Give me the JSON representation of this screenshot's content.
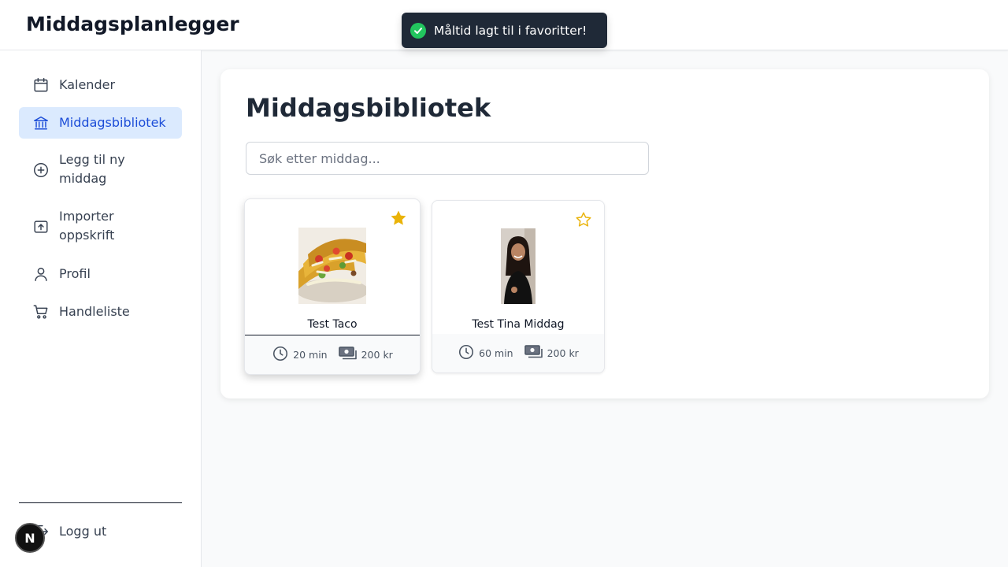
{
  "app": {
    "title": "Middagsplanlegger"
  },
  "toast": {
    "message": "Måltid lagt til i favoritter!",
    "color": "#1f2937",
    "icon": "check-circle-icon"
  },
  "sidebar": {
    "items": [
      {
        "label": "Kalender",
        "icon": "calendar-icon",
        "active": false
      },
      {
        "label": "Middagsbibliotek",
        "icon": "library-icon",
        "active": true
      },
      {
        "label": "Legg til ny middag",
        "icon": "plus-circle-icon",
        "active": false
      },
      {
        "label": "Importer oppskrift",
        "icon": "upload-icon",
        "active": false
      },
      {
        "label": "Profil",
        "icon": "user-icon",
        "active": false
      },
      {
        "label": "Handleliste",
        "icon": "cart-icon",
        "active": false
      }
    ],
    "logout": {
      "label": "Logg ut",
      "icon": "logout-icon"
    }
  },
  "main": {
    "title": "Middagsbibliotek",
    "search": {
      "placeholder": "Søk etter middag...",
      "value": ""
    },
    "meals": [
      {
        "name": "Test Taco",
        "time": "20 min",
        "cost": "200 kr",
        "favorite": true
      },
      {
        "name": "Test Tina Middag",
        "time": "60 min",
        "cost": "200 kr",
        "favorite": false
      }
    ]
  },
  "badge": {
    "letter": "N"
  },
  "colors": {
    "accent": "#1d4ed8",
    "active_bg": "#dbeafe",
    "star": "#eab308",
    "toast_success": "#22c55e"
  }
}
